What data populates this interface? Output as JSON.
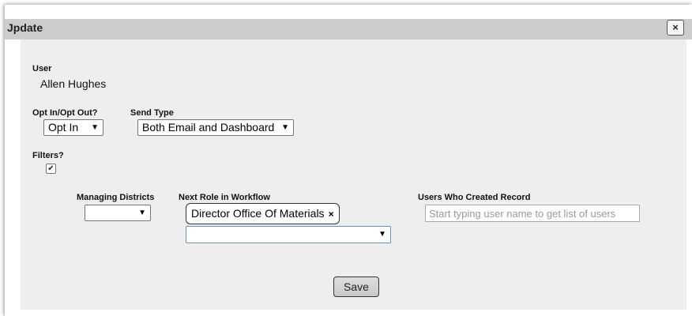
{
  "dialog": {
    "title": "Jpdate",
    "close_icon": "×"
  },
  "user": {
    "label": "User",
    "value": "Allen Hughes"
  },
  "opt": {
    "label": "Opt In/Opt Out?",
    "selected": "Opt In"
  },
  "send_type": {
    "label": "Send Type",
    "selected": "Both Email and Dashboard"
  },
  "filters": {
    "label": "Filters?",
    "checked": true,
    "check_glyph": "✔"
  },
  "managing_districts": {
    "label": "Managing Districts",
    "selected": ""
  },
  "next_role": {
    "label": "Next Role in Workflow",
    "chip_text": "Director Office Of Materials",
    "chip_remove": "×",
    "select_value": ""
  },
  "users_created": {
    "label": "Users Who Created Record",
    "placeholder": "Start typing user name to get list of users"
  },
  "save_label": "Save",
  "caret": "▼"
}
